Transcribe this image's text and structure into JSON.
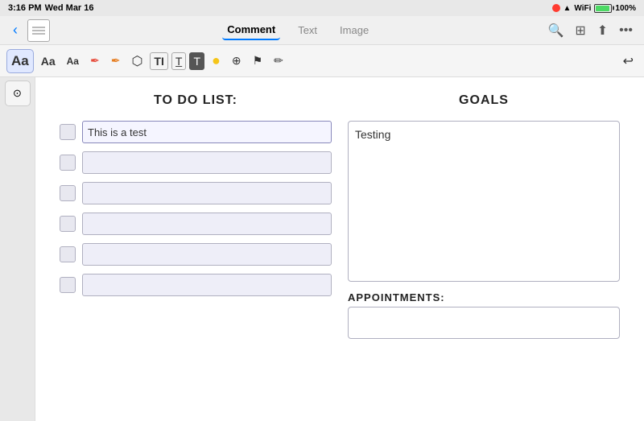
{
  "statusBar": {
    "time": "3:16 PM",
    "date": "Wed Mar 16",
    "redDot": true,
    "signal": "▲▲▲",
    "wifi": "WiFi",
    "battery": "100%"
  },
  "navBar": {
    "backLabel": "‹",
    "tabs": [
      {
        "id": "comment",
        "label": "Comment",
        "active": true
      },
      {
        "id": "text",
        "label": "Text",
        "active": false
      },
      {
        "id": "image",
        "label": "Image",
        "active": false
      }
    ],
    "rightIcons": [
      "search",
      "grid",
      "share",
      "more"
    ]
  },
  "toolbar": {
    "buttons": [
      {
        "id": "aa-large",
        "label": "Aa",
        "size": "large",
        "active": true
      },
      {
        "id": "aa-medium",
        "label": "Aa",
        "size": "medium",
        "active": false
      },
      {
        "id": "aa-small",
        "label": "Aa",
        "size": "small",
        "active": false
      },
      {
        "id": "pen-red",
        "label": "✏",
        "color": "red",
        "active": false
      },
      {
        "id": "pen-orange",
        "label": "✏",
        "color": "orange",
        "active": false
      },
      {
        "id": "eraser",
        "label": "⌫",
        "active": false
      },
      {
        "id": "ti-box",
        "label": "TI",
        "active": false
      },
      {
        "id": "t-outline",
        "label": "T̲",
        "active": false
      },
      {
        "id": "t-fill",
        "label": "𝕋",
        "active": false
      },
      {
        "id": "yellow-dot",
        "label": "●",
        "color": "yellow",
        "active": false
      },
      {
        "id": "link",
        "label": "⊕",
        "active": false
      },
      {
        "id": "person",
        "label": "⚑",
        "active": false
      },
      {
        "id": "pen2",
        "label": "✒",
        "active": false
      }
    ],
    "undoLabel": "↩"
  },
  "page": {
    "todoSection": {
      "title": "TO DO LIST:",
      "items": [
        {
          "id": 1,
          "text": "This is a test",
          "checked": false,
          "active": true
        },
        {
          "id": 2,
          "text": "",
          "checked": false,
          "active": false
        },
        {
          "id": 3,
          "text": "",
          "checked": false,
          "active": false
        },
        {
          "id": 4,
          "text": "",
          "checked": false,
          "active": false
        },
        {
          "id": 5,
          "text": "",
          "checked": false,
          "active": false
        },
        {
          "id": 6,
          "text": "",
          "checked": false,
          "active": false
        }
      ]
    },
    "goalsSection": {
      "title": "GOALS",
      "text": "Testing"
    },
    "appointmentsSection": {
      "title": "APPOINTMENTS:"
    }
  }
}
